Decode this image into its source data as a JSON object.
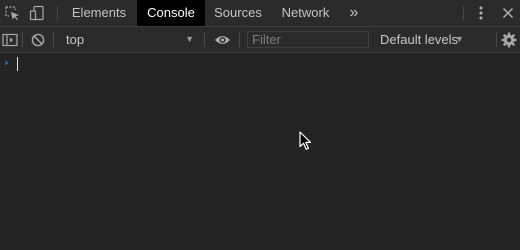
{
  "tabbar": {
    "tabs": [
      {
        "label": "Elements",
        "active": false
      },
      {
        "label": "Console",
        "active": true
      },
      {
        "label": "Sources",
        "active": false
      },
      {
        "label": "Network",
        "active": false
      }
    ],
    "more_tabs_glyph": "»",
    "icons": [
      "inspect-element-icon",
      "device-toolbar-icon",
      "more-tabs-icon",
      "kebab-menu-icon",
      "close-icon"
    ]
  },
  "toolbar": {
    "context_value": "top",
    "filter_placeholder": "Filter",
    "filter_value": "",
    "levels_label": "Default levels",
    "icons": [
      "sidebar-toggle-icon",
      "clear-console-icon",
      "dropdown-caret-icon",
      "live-expression-eye-icon",
      "settings-gear-icon"
    ]
  },
  "console": {
    "prompt_symbol": "›",
    "input_value": ""
  },
  "colors": {
    "background": "#242424",
    "toolbar": "#2b2b2b",
    "active_tab": "#000000",
    "prompt_blue": "#4a8ce8"
  }
}
